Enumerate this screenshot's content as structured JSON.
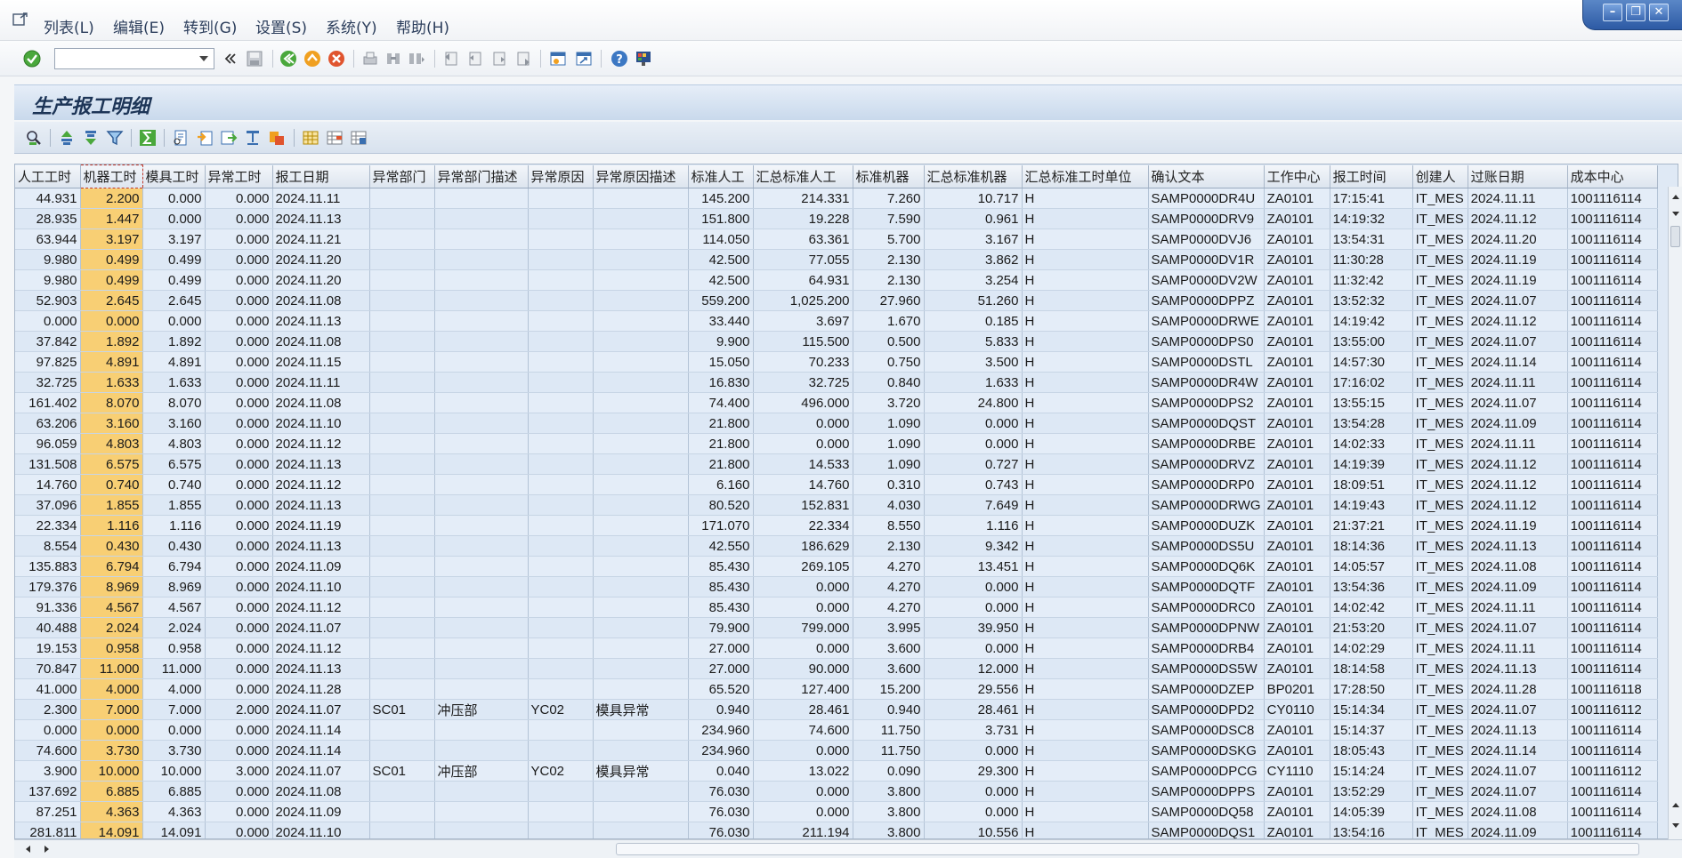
{
  "menubar": {
    "items": [
      "列表(L)",
      "编辑(E)",
      "转到(G)",
      "设置(S)",
      "系统(Y)",
      "帮助(H)"
    ]
  },
  "toolbar": {
    "command_field": {
      "value": "",
      "placeholder": ""
    },
    "icons": [
      "enter-icon",
      "save-icon",
      "back-icon",
      "exit-icon",
      "cancel-icon",
      "print-icon",
      "find-icon",
      "find-next-icon",
      "first-page-icon",
      "previous-page-icon",
      "next-page-icon",
      "last-page-icon",
      "create-session-icon",
      "shortcut-icon",
      "help-icon",
      "customize-layout-icon"
    ]
  },
  "title": "生产报工明细",
  "app_toolbar": {
    "icons": [
      "details-icon",
      "sort-ascending-icon",
      "sort-descending-icon",
      "filter-icon",
      "total-icon",
      "print-preview-icon",
      "export-icon",
      "send-icon",
      "graphic-icon",
      "abc-analysis-icon",
      "select-layout-icon",
      "change-layout-icon",
      "save-layout-icon"
    ]
  },
  "colors": {
    "highlight_column": "#f8cf74",
    "row_bg": "#e4edf8",
    "title_text": "#1d3557"
  },
  "grid": {
    "columns": [
      "人工工时",
      "机器工时",
      "模具工时",
      "异常工时",
      "报工日期",
      "异常部门",
      "异常部门描述",
      "异常原因",
      "异常原因描述",
      "标准人工",
      "汇总标准人工",
      "标准机器",
      "汇总标准机器",
      "汇总标准工时单位",
      "确认文本",
      "工作中心",
      "报工时间",
      "创建人",
      "过账日期",
      "成本中心"
    ],
    "rows": [
      [
        "44.931",
        "2.200",
        "0.000",
        "0.000",
        "2024.11.11",
        "",
        "",
        "",
        "",
        "145.200",
        "214.331",
        "7.260",
        "10.717",
        "H",
        "SAMP0000DR4U",
        "ZA0101",
        "17:15:41",
        "IT_MES",
        "2024.11.11",
        "1001116114"
      ],
      [
        "28.935",
        "1.447",
        "0.000",
        "0.000",
        "2024.11.13",
        "",
        "",
        "",
        "",
        "151.800",
        "19.228",
        "7.590",
        "0.961",
        "H",
        "SAMP0000DRV9",
        "ZA0101",
        "14:19:32",
        "IT_MES",
        "2024.11.12",
        "1001116114"
      ],
      [
        "63.944",
        "3.197",
        "3.197",
        "0.000",
        "2024.11.21",
        "",
        "",
        "",
        "",
        "114.050",
        "63.361",
        "5.700",
        "3.167",
        "H",
        "SAMP0000DVJ6",
        "ZA0101",
        "13:54:31",
        "IT_MES",
        "2024.11.20",
        "1001116114"
      ],
      [
        "9.980",
        "0.499",
        "0.499",
        "0.000",
        "2024.11.20",
        "",
        "",
        "",
        "",
        "42.500",
        "77.055",
        "2.130",
        "3.862",
        "H",
        "SAMP0000DV1R",
        "ZA0101",
        "11:30:28",
        "IT_MES",
        "2024.11.19",
        "1001116114"
      ],
      [
        "9.980",
        "0.499",
        "0.499",
        "0.000",
        "2024.11.20",
        "",
        "",
        "",
        "",
        "42.500",
        "64.931",
        "2.130",
        "3.254",
        "H",
        "SAMP0000DV2W",
        "ZA0101",
        "11:32:42",
        "IT_MES",
        "2024.11.19",
        "1001116114"
      ],
      [
        "52.903",
        "2.645",
        "2.645",
        "0.000",
        "2024.11.08",
        "",
        "",
        "",
        "",
        "559.200",
        "1,025.200",
        "27.960",
        "51.260",
        "H",
        "SAMP0000DPPZ",
        "ZA0101",
        "13:52:32",
        "IT_MES",
        "2024.11.07",
        "1001116114"
      ],
      [
        "0.000",
        "0.000",
        "0.000",
        "0.000",
        "2024.11.13",
        "",
        "",
        "",
        "",
        "33.440",
        "3.697",
        "1.670",
        "0.185",
        "H",
        "SAMP0000DRWE",
        "ZA0101",
        "14:19:42",
        "IT_MES",
        "2024.11.12",
        "1001116114"
      ],
      [
        "37.842",
        "1.892",
        "1.892",
        "0.000",
        "2024.11.08",
        "",
        "",
        "",
        "",
        "9.900",
        "115.500",
        "0.500",
        "5.833",
        "H",
        "SAMP0000DPS0",
        "ZA0101",
        "13:55:00",
        "IT_MES",
        "2024.11.07",
        "1001116114"
      ],
      [
        "97.825",
        "4.891",
        "4.891",
        "0.000",
        "2024.11.15",
        "",
        "",
        "",
        "",
        "15.050",
        "70.233",
        "0.750",
        "3.500",
        "H",
        "SAMP0000DSTL",
        "ZA0101",
        "14:57:30",
        "IT_MES",
        "2024.11.14",
        "1001116114"
      ],
      [
        "32.725",
        "1.633",
        "1.633",
        "0.000",
        "2024.11.11",
        "",
        "",
        "",
        "",
        "16.830",
        "32.725",
        "0.840",
        "1.633",
        "H",
        "SAMP0000DR4W",
        "ZA0101",
        "17:16:02",
        "IT_MES",
        "2024.11.11",
        "1001116114"
      ],
      [
        "161.402",
        "8.070",
        "8.070",
        "0.000",
        "2024.11.08",
        "",
        "",
        "",
        "",
        "74.400",
        "496.000",
        "3.720",
        "24.800",
        "H",
        "SAMP0000DPS2",
        "ZA0101",
        "13:55:15",
        "IT_MES",
        "2024.11.07",
        "1001116114"
      ],
      [
        "63.206",
        "3.160",
        "3.160",
        "0.000",
        "2024.11.10",
        "",
        "",
        "",
        "",
        "21.800",
        "0.000",
        "1.090",
        "0.000",
        "H",
        "SAMP0000DQST",
        "ZA0101",
        "13:54:28",
        "IT_MES",
        "2024.11.09",
        "1001116114"
      ],
      [
        "96.059",
        "4.803",
        "4.803",
        "0.000",
        "2024.11.12",
        "",
        "",
        "",
        "",
        "21.800",
        "0.000",
        "1.090",
        "0.000",
        "H",
        "SAMP0000DRBE",
        "ZA0101",
        "14:02:33",
        "IT_MES",
        "2024.11.11",
        "1001116114"
      ],
      [
        "131.508",
        "6.575",
        "6.575",
        "0.000",
        "2024.11.13",
        "",
        "",
        "",
        "",
        "21.800",
        "14.533",
        "1.090",
        "0.727",
        "H",
        "SAMP0000DRVZ",
        "ZA0101",
        "14:19:39",
        "IT_MES",
        "2024.11.12",
        "1001116114"
      ],
      [
        "14.760",
        "0.740",
        "0.740",
        "0.000",
        "2024.11.12",
        "",
        "",
        "",
        "",
        "6.160",
        "14.760",
        "0.310",
        "0.743",
        "H",
        "SAMP0000DRP0",
        "ZA0101",
        "18:09:51",
        "IT_MES",
        "2024.11.12",
        "1001116114"
      ],
      [
        "37.096",
        "1.855",
        "1.855",
        "0.000",
        "2024.11.13",
        "",
        "",
        "",
        "",
        "80.520",
        "152.831",
        "4.030",
        "7.649",
        "H",
        "SAMP0000DRWG",
        "ZA0101",
        "14:19:43",
        "IT_MES",
        "2024.11.12",
        "1001116114"
      ],
      [
        "22.334",
        "1.116",
        "1.116",
        "0.000",
        "2024.11.19",
        "",
        "",
        "",
        "",
        "171.070",
        "22.334",
        "8.550",
        "1.116",
        "H",
        "SAMP0000DUZK",
        "ZA0101",
        "21:37:21",
        "IT_MES",
        "2024.11.19",
        "1001116114"
      ],
      [
        "8.554",
        "0.430",
        "0.430",
        "0.000",
        "2024.11.13",
        "",
        "",
        "",
        "",
        "42.550",
        "186.629",
        "2.130",
        "9.342",
        "H",
        "SAMP0000DS5U",
        "ZA0101",
        "18:14:36",
        "IT_MES",
        "2024.11.13",
        "1001116114"
      ],
      [
        "135.883",
        "6.794",
        "6.794",
        "0.000",
        "2024.11.09",
        "",
        "",
        "",
        "",
        "85.430",
        "269.105",
        "4.270",
        "13.451",
        "H",
        "SAMP0000DQ6K",
        "ZA0101",
        "14:05:57",
        "IT_MES",
        "2024.11.08",
        "1001116114"
      ],
      [
        "179.376",
        "8.969",
        "8.969",
        "0.000",
        "2024.11.10",
        "",
        "",
        "",
        "",
        "85.430",
        "0.000",
        "4.270",
        "0.000",
        "H",
        "SAMP0000DQTF",
        "ZA0101",
        "13:54:36",
        "IT_MES",
        "2024.11.09",
        "1001116114"
      ],
      [
        "91.336",
        "4.567",
        "4.567",
        "0.000",
        "2024.11.12",
        "",
        "",
        "",
        "",
        "85.430",
        "0.000",
        "4.270",
        "0.000",
        "H",
        "SAMP0000DRC0",
        "ZA0101",
        "14:02:42",
        "IT_MES",
        "2024.11.11",
        "1001116114"
      ],
      [
        "40.488",
        "2.024",
        "2.024",
        "0.000",
        "2024.11.07",
        "",
        "",
        "",
        "",
        "79.900",
        "799.000",
        "3.995",
        "39.950",
        "H",
        "SAMP0000DPNW",
        "ZA0101",
        "21:53:20",
        "IT_MES",
        "2024.11.07",
        "1001116114"
      ],
      [
        "19.153",
        "0.958",
        "0.958",
        "0.000",
        "2024.11.12",
        "",
        "",
        "",
        "",
        "27.000",
        "0.000",
        "3.600",
        "0.000",
        "H",
        "SAMP0000DRB4",
        "ZA0101",
        "14:02:29",
        "IT_MES",
        "2024.11.11",
        "1001116114"
      ],
      [
        "70.847",
        "11.000",
        "11.000",
        "0.000",
        "2024.11.13",
        "",
        "",
        "",
        "",
        "27.000",
        "90.000",
        "3.600",
        "12.000",
        "H",
        "SAMP0000DS5W",
        "ZA0101",
        "18:14:58",
        "IT_MES",
        "2024.11.13",
        "1001116114"
      ],
      [
        "41.000",
        "4.000",
        "4.000",
        "0.000",
        "2024.11.28",
        "",
        "",
        "",
        "",
        "65.520",
        "127.400",
        "15.200",
        "29.556",
        "H",
        "SAMP0000DZEP",
        "BP0201",
        "17:28:50",
        "IT_MES",
        "2024.11.28",
        "1001116118"
      ],
      [
        "2.300",
        "7.000",
        "7.000",
        "2.000",
        "2024.11.07",
        "SC01",
        "冲压部",
        "YC02",
        "模具异常",
        "0.940",
        "28.461",
        "0.940",
        "28.461",
        "H",
        "SAMP0000DPD2",
        "CY0110",
        "15:14:34",
        "IT_MES",
        "2024.11.07",
        "1001116112"
      ],
      [
        "0.000",
        "0.000",
        "0.000",
        "0.000",
        "2024.11.14",
        "",
        "",
        "",
        "",
        "234.960",
        "74.600",
        "11.750",
        "3.731",
        "H",
        "SAMP0000DSC8",
        "ZA0101",
        "15:14:37",
        "IT_MES",
        "2024.11.13",
        "1001116114"
      ],
      [
        "74.600",
        "3.730",
        "3.730",
        "0.000",
        "2024.11.14",
        "",
        "",
        "",
        "",
        "234.960",
        "0.000",
        "11.750",
        "0.000",
        "H",
        "SAMP0000DSKG",
        "ZA0101",
        "18:05:43",
        "IT_MES",
        "2024.11.14",
        "1001116114"
      ],
      [
        "3.900",
        "10.000",
        "10.000",
        "3.000",
        "2024.11.07",
        "SC01",
        "冲压部",
        "YC02",
        "模具异常",
        "0.040",
        "13.022",
        "0.090",
        "29.300",
        "H",
        "SAMP0000DPCG",
        "CY1110",
        "15:14:24",
        "IT_MES",
        "2024.11.07",
        "1001116112"
      ],
      [
        "137.692",
        "6.885",
        "6.885",
        "0.000",
        "2024.11.08",
        "",
        "",
        "",
        "",
        "76.030",
        "0.000",
        "3.800",
        "0.000",
        "H",
        "SAMP0000DPPS",
        "ZA0101",
        "13:52:29",
        "IT_MES",
        "2024.11.07",
        "1001116114"
      ],
      [
        "87.251",
        "4.363",
        "4.363",
        "0.000",
        "2024.11.09",
        "",
        "",
        "",
        "",
        "76.030",
        "0.000",
        "3.800",
        "0.000",
        "H",
        "SAMP0000DQ58",
        "ZA0101",
        "14:05:39",
        "IT_MES",
        "2024.11.08",
        "1001116114"
      ],
      [
        "281.811",
        "14.091",
        "14.091",
        "0.000",
        "2024.11.10",
        "",
        "",
        "",
        "",
        "76.030",
        "211.194",
        "3.800",
        "10.556",
        "H",
        "SAMP0000DQS1",
        "ZA0101",
        "13:54:16",
        "IT_MES",
        "2024.11.09",
        "1001116114"
      ]
    ]
  }
}
